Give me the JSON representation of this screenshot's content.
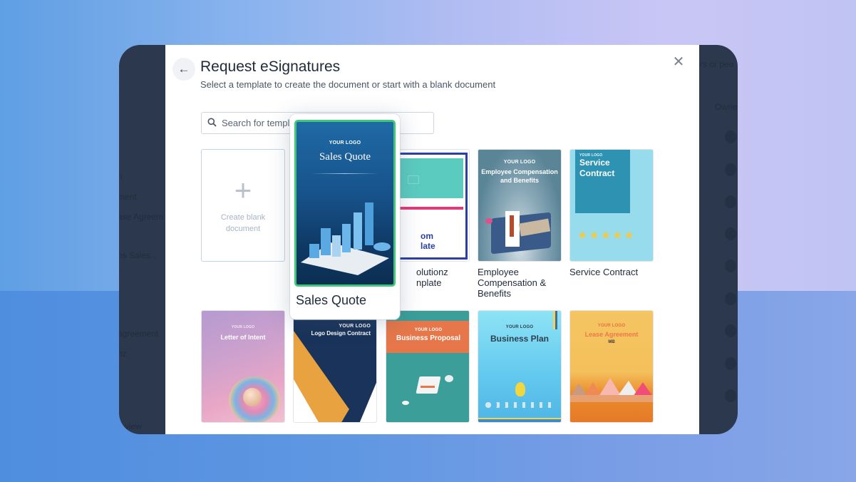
{
  "background_app": {
    "left_fragments": [
      "n",
      "ment",
      "ase Agreem",
      "ns Sales...",
      "agreement",
      "nz",
      "n view"
    ],
    "right_fragments": [
      "rs or peo",
      "Owne"
    ],
    "avatar_count": 9
  },
  "modal": {
    "back_icon": "arrow-left-icon",
    "title": "Request eSignatures",
    "subtitle": "Select a template to create the document or start with a blank document",
    "close_icon": "close-icon",
    "search": {
      "icon": "search-icon",
      "placeholder": "Search for templates",
      "value": ""
    },
    "blank_card": {
      "icon": "plus-icon",
      "line1": "Create blank",
      "line2": "document"
    },
    "templates": [
      {
        "name": "Solutionz Custom Template",
        "visible_label_1": "olutionz",
        "visible_label_2": "nplate",
        "thumb_text_1": "om",
        "thumb_text_2": "late"
      },
      {
        "name": "Employee Compensation & Benefits",
        "label_1": "Employee",
        "label_2": "Compensation &",
        "label_3": "Benefits",
        "logo": "YOUR LOGO",
        "thumb_title_1": "Employee Compensation",
        "thumb_title_2": "and Benefits"
      },
      {
        "name": "Service Contract",
        "label": "Service Contract",
        "logo": "YOUR LOGO",
        "thumb_title_1": "Service",
        "thumb_title_2": "Contract",
        "stars": 5
      },
      {
        "name": "Letter of Intent",
        "logo": "YOUR LOGO",
        "thumb_title": "Letter of Intent"
      },
      {
        "name": "Logo Design Contract",
        "logo": "YOUR LOGO",
        "thumb_title": "Logo Design Contract"
      },
      {
        "name": "Business Proposal",
        "logo": "YOUR LOGO",
        "thumb_title": "Business Proposal"
      },
      {
        "name": "Business Plan",
        "logo": "YOUR LOGO",
        "thumb_title": "Business Plan"
      },
      {
        "name": "Lease Agreement",
        "logo": "YOUR LOGO",
        "thumb_title": "Lease Agreement",
        "thumb_sub": "MB"
      }
    ],
    "hover_preview": {
      "name": "Sales Quote",
      "logo": "YOUR LOGO",
      "thumb_title": "Sales Quote",
      "label": "Sales Quote",
      "highlight_color": "#3fc77a"
    }
  }
}
